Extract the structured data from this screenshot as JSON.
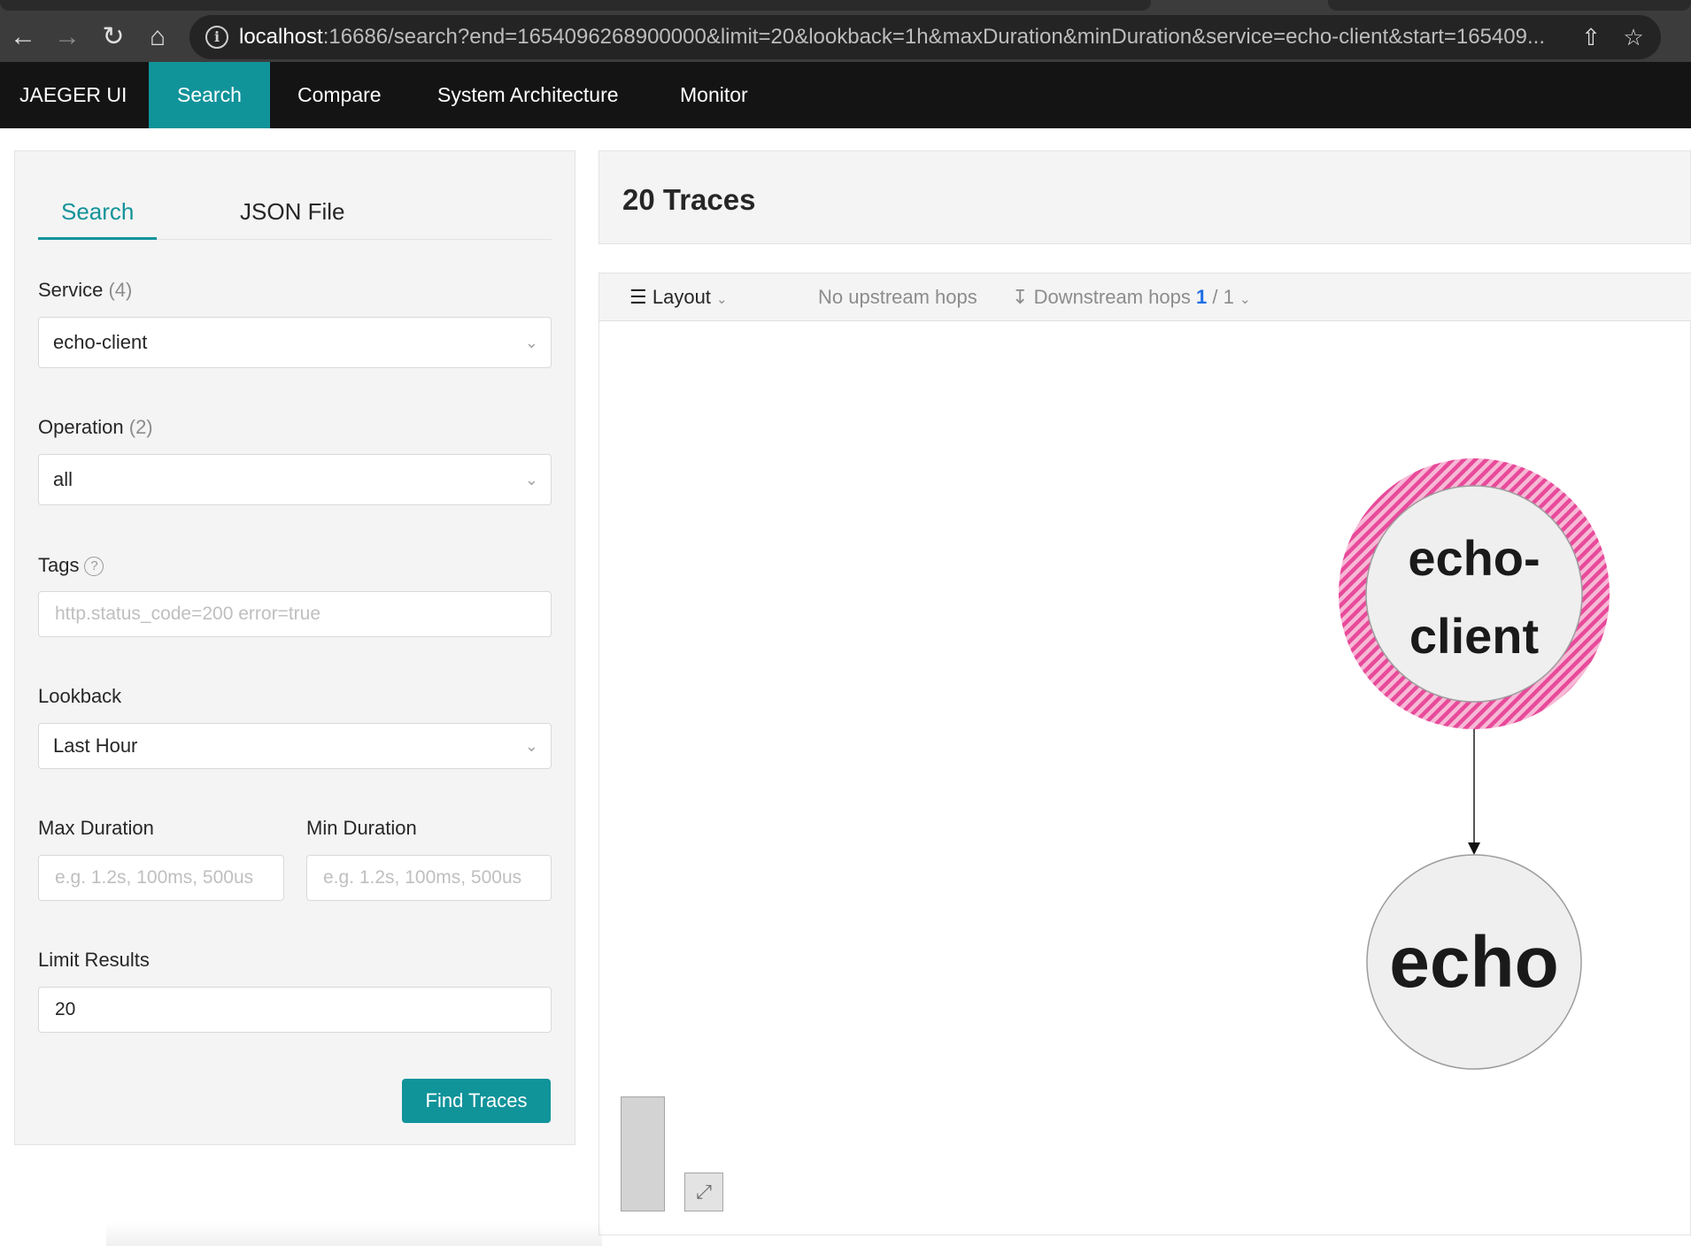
{
  "browser": {
    "url_host": "localhost",
    "url_rest": ":16686/search?end=1654096268900000&limit=20&lookback=1h&maxDuration&minDuration&service=echo-client&start=165409..."
  },
  "nav": {
    "brand": "JAEGER UI",
    "items": [
      "Search",
      "Compare",
      "System Architecture",
      "Monitor"
    ],
    "active": "Search"
  },
  "search_panel": {
    "tabs": [
      "Search",
      "JSON File"
    ],
    "service": {
      "label": "Service",
      "count": "(4)",
      "value": "echo-client"
    },
    "operation": {
      "label": "Operation",
      "count": "(2)",
      "value": "all"
    },
    "tags": {
      "label": "Tags",
      "help": "?",
      "placeholder": "http.status_code=200 error=true"
    },
    "lookback": {
      "label": "Lookback",
      "value": "Last Hour"
    },
    "max_duration": {
      "label": "Max Duration",
      "placeholder": "e.g. 1.2s, 100ms, 500us"
    },
    "min_duration": {
      "label": "Min Duration",
      "placeholder": "e.g. 1.2s, 100ms, 500us"
    },
    "limit": {
      "label": "Limit Results",
      "value": "20"
    },
    "find_button": "Find Traces"
  },
  "results": {
    "title": "20 Traces",
    "toolbar": {
      "layout": "Layout",
      "upstream": "No upstream hops",
      "downstream_label": "Downstream hops",
      "downstream_current": "1",
      "downstream_total": "/ 1"
    }
  },
  "graph": {
    "nodes": [
      {
        "line1": "echo-",
        "line2": "client",
        "focal": true
      },
      {
        "line1": "echo",
        "focal": false
      }
    ],
    "colors": {
      "focal_ring": "#e84a9a",
      "node_fill": "#efefef",
      "node_stroke": "#9d9d9d"
    }
  },
  "theme": {
    "accent": "#11939a",
    "nav_bg": "#141414",
    "link_blue": "#1f6fe5"
  }
}
